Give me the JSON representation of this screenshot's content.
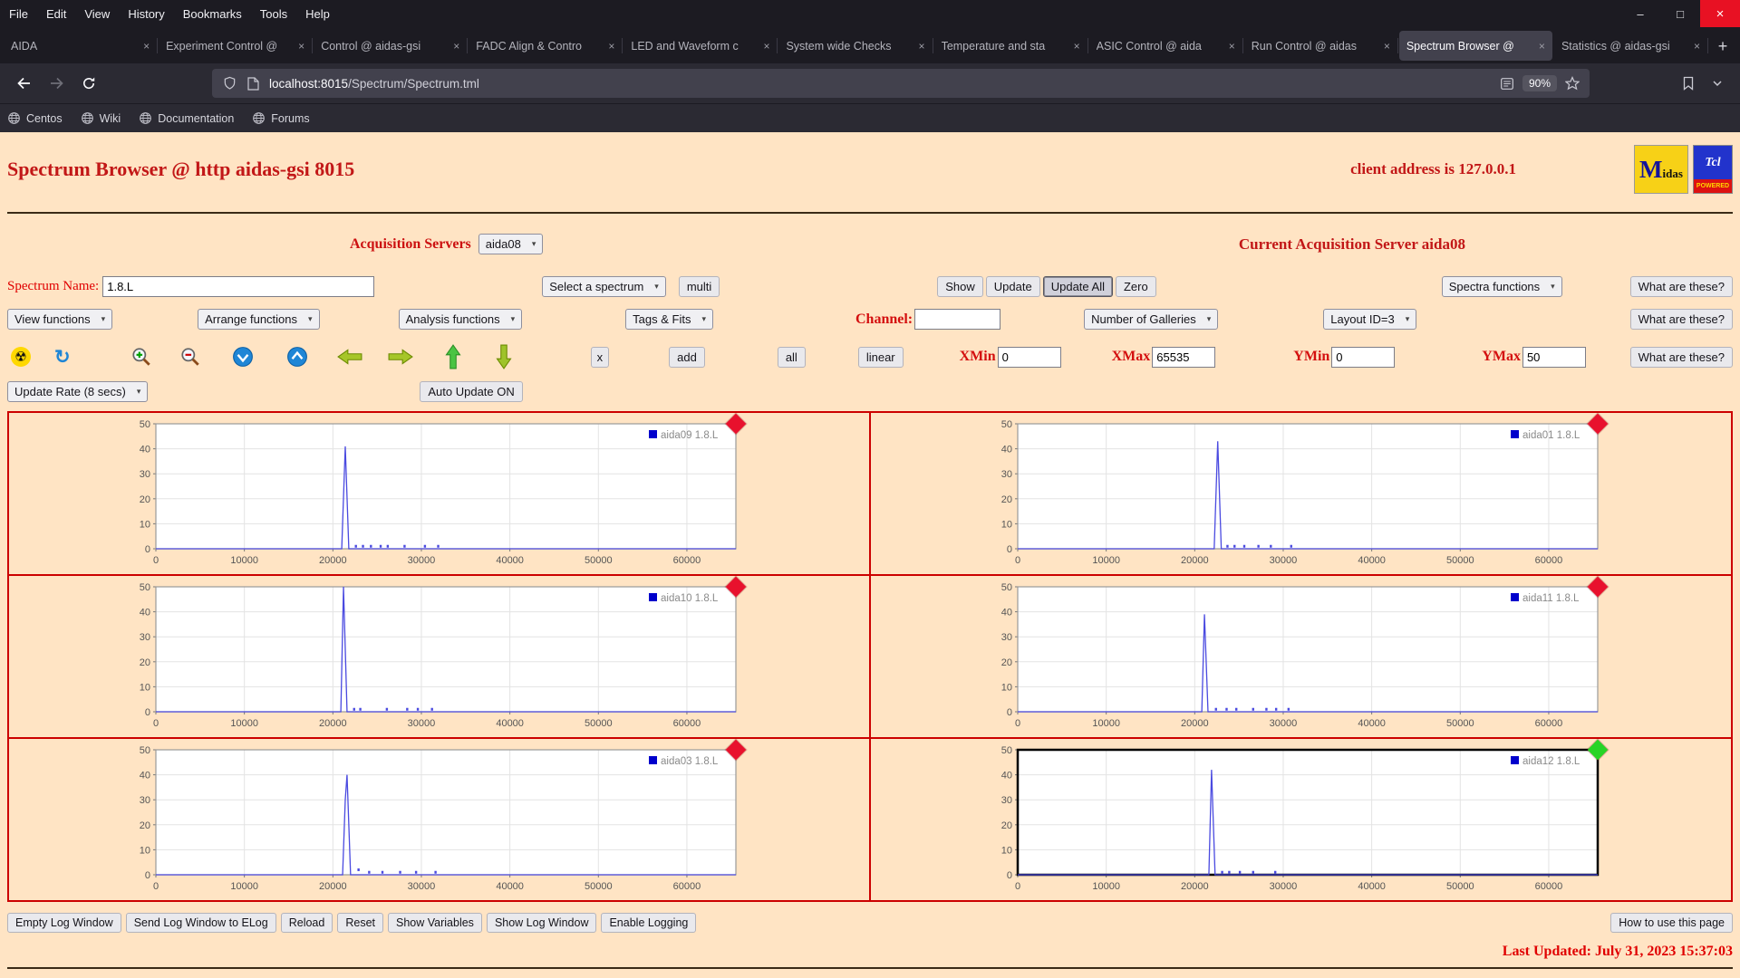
{
  "icons": {
    "close": "×",
    "minimize": "–",
    "maximize": "□",
    "new_tab": "+",
    "caret": "▾",
    "radiation": "☢",
    "refresh": "↻"
  },
  "colors": {
    "page_bg": "#ffe4c4",
    "label_red": "#e00000",
    "header_red": "#c21717",
    "panel_border": "#cc0000",
    "spectrum_line": "#4a4ae0",
    "legend_square": "#0000cc",
    "status_red": "#e8112d",
    "status_green": "#27d427"
  },
  "browser": {
    "menu": {
      "items": [
        "File",
        "Edit",
        "View",
        "History",
        "Bookmarks",
        "Tools",
        "Help"
      ]
    },
    "tabs": [
      {
        "title": "AIDA",
        "active": false
      },
      {
        "title": "Experiment Control @",
        "active": false
      },
      {
        "title": "Control @ aidas-gsi",
        "active": false
      },
      {
        "title": "FADC Align & Contro",
        "active": false
      },
      {
        "title": "LED and Waveform c",
        "active": false
      },
      {
        "title": "System wide Checks",
        "active": false
      },
      {
        "title": "Temperature and sta",
        "active": false
      },
      {
        "title": "ASIC Control @ aida",
        "active": false
      },
      {
        "title": "Run Control @ aidas",
        "active": false
      },
      {
        "title": "Spectrum Browser @",
        "active": true
      },
      {
        "title": "Statistics @ aidas-gsi",
        "active": false
      }
    ],
    "nav": {
      "url_host": "localhost:8015",
      "url_path": "/Spectrum/Spectrum.tml",
      "zoom": "90%"
    },
    "bookmarks": [
      "Centos",
      "Wiki",
      "Documentation",
      "Forums"
    ]
  },
  "page": {
    "title": "Spectrum Browser @ http aidas-gsi 8015",
    "client_address": "client address is 127.0.0.1",
    "logos": {
      "midas": "Midas",
      "tcl_top": "Tcl",
      "tcl_bottom": "POWERED"
    },
    "acquisition": {
      "label": "Acquisition Servers",
      "selected": "aida08",
      "current": "Current Acquisition Server aida08"
    },
    "row1": {
      "spectrum_name_label": "Spectrum Name:",
      "spectrum_name_value": "1.8.L",
      "select_spectrum": "Select a spectrum",
      "multi": "multi",
      "show": "Show",
      "update": "Update",
      "update_all": "Update All",
      "zero": "Zero",
      "spectra_functions": "Spectra functions",
      "help": "What are these?"
    },
    "row2": {
      "view_functions": "View functions",
      "arrange_functions": "Arrange functions",
      "analysis_functions": "Analysis functions",
      "tags_fits": "Tags & Fits",
      "channel_label": "Channel:",
      "channel_value": "",
      "number_of_galleries": "Number of Galleries",
      "layout_id": "Layout ID=3",
      "help": "What are these?"
    },
    "row3": {
      "x": "x",
      "add": "add",
      "all": "all",
      "linear": "linear",
      "xmin_label": "XMin",
      "xmin": "0",
      "xmax_label": "XMax",
      "xmax": "65535",
      "ymin_label": "YMin",
      "ymin": "0",
      "ymax_label": "YMax",
      "ymax": "50",
      "help": "What are these?"
    },
    "row4": {
      "update_rate": "Update Rate (8 secs)",
      "auto_update": "Auto Update ON"
    },
    "footer": {
      "buttons": [
        "Empty Log Window",
        "Send Log Window to ELog",
        "Reload",
        "Reset",
        "Show Variables",
        "Show Log Window",
        "Enable Logging"
      ],
      "help": "How to use this page",
      "last_updated": "Last Updated: July 31, 2023 15:37:03"
    }
  },
  "gallery": {
    "axes": {
      "xmin": 0,
      "xmax": 65535,
      "ymin": 0,
      "ymax": 50,
      "x_ticks": [
        0,
        10000,
        20000,
        30000,
        40000,
        50000,
        60000
      ],
      "y_ticks": [
        0,
        10,
        20,
        30,
        40,
        50
      ]
    },
    "panels": [
      {
        "legend": "aida09 1.8.L",
        "status": "#e8112d",
        "selected": false,
        "chart": 0
      },
      {
        "legend": "aida01 1.8.L",
        "status": "#e8112d",
        "selected": false,
        "chart": 1
      },
      {
        "legend": "aida10 1.8.L",
        "status": "#e8112d",
        "selected": false,
        "chart": 2
      },
      {
        "legend": "aida11 1.8.L",
        "status": "#e8112d",
        "selected": false,
        "chart": 3
      },
      {
        "legend": "aida03 1.8.L",
        "status": "#e8112d",
        "selected": false,
        "chart": 4
      },
      {
        "legend": "aida12 1.8.L",
        "status": "#27d427",
        "selected": true,
        "chart": 5
      }
    ]
  },
  "chart_data": [
    {
      "type": "line",
      "title": "aida09 1.8.L",
      "xlim": [
        0,
        65535
      ],
      "ylim": [
        0,
        50
      ],
      "series": [
        {
          "name": "aida09 1.8.L",
          "points": [
            [
              0,
              0
            ],
            [
              21000,
              0
            ],
            [
              21400,
              41
            ],
            [
              21800,
              0
            ],
            [
              65535,
              0
            ]
          ]
        }
      ],
      "noise_points": [
        [
          22600,
          1
        ],
        [
          23400,
          1
        ],
        [
          24300,
          1
        ],
        [
          25400,
          1
        ],
        [
          26200,
          1
        ],
        [
          28100,
          1
        ],
        [
          30400,
          1
        ],
        [
          31900,
          1
        ]
      ]
    },
    {
      "type": "line",
      "title": "aida01 1.8.L",
      "xlim": [
        0,
        65535
      ],
      "ylim": [
        0,
        50
      ],
      "series": [
        {
          "name": "aida01 1.8.L",
          "points": [
            [
              0,
              0
            ],
            [
              22200,
              0
            ],
            [
              22600,
              43
            ],
            [
              23000,
              0
            ],
            [
              65535,
              0
            ]
          ]
        }
      ],
      "noise_points": [
        [
          23700,
          1
        ],
        [
          24500,
          1
        ],
        [
          25600,
          1
        ],
        [
          27200,
          1
        ],
        [
          28600,
          1
        ],
        [
          30900,
          1
        ]
      ]
    },
    {
      "type": "line",
      "title": "aida10 1.8.L",
      "xlim": [
        0,
        65535
      ],
      "ylim": [
        0,
        50
      ],
      "series": [
        {
          "name": "aida10 1.8.L",
          "points": [
            [
              0,
              0
            ],
            [
              20900,
              0
            ],
            [
              21200,
              50
            ],
            [
              21600,
              0
            ],
            [
              65535,
              0
            ]
          ]
        }
      ],
      "noise_points": [
        [
          22400,
          1
        ],
        [
          23100,
          1
        ],
        [
          26100,
          1
        ],
        [
          28400,
          1
        ],
        [
          29600,
          1
        ],
        [
          31200,
          1
        ]
      ]
    },
    {
      "type": "line",
      "title": "aida11 1.8.L",
      "xlim": [
        0,
        65535
      ],
      "ylim": [
        0,
        50
      ],
      "series": [
        {
          "name": "aida11 1.8.L",
          "points": [
            [
              0,
              0
            ],
            [
              20800,
              0
            ],
            [
              21100,
              39
            ],
            [
              21500,
              0
            ],
            [
              65535,
              0
            ]
          ]
        }
      ],
      "noise_points": [
        [
          22400,
          1
        ],
        [
          23600,
          1
        ],
        [
          24700,
          1
        ],
        [
          26600,
          1
        ],
        [
          28100,
          1
        ],
        [
          29200,
          1
        ],
        [
          30600,
          1
        ]
      ]
    },
    {
      "type": "line",
      "title": "aida03 1.8.L",
      "xlim": [
        0,
        65535
      ],
      "ylim": [
        0,
        50
      ],
      "series": [
        {
          "name": "aida03 1.8.L",
          "points": [
            [
              0,
              0
            ],
            [
              21100,
              0
            ],
            [
              21400,
              30
            ],
            [
              21600,
              40
            ],
            [
              22000,
              0
            ],
            [
              65535,
              0
            ]
          ]
        }
      ],
      "noise_points": [
        [
          22900,
          2
        ],
        [
          24100,
          1
        ],
        [
          25600,
          1
        ],
        [
          27600,
          1
        ],
        [
          29400,
          1
        ],
        [
          31600,
          1
        ]
      ]
    },
    {
      "type": "line",
      "title": "aida12 1.8.L",
      "xlim": [
        0,
        65535
      ],
      "ylim": [
        0,
        50
      ],
      "series": [
        {
          "name": "aida12 1.8.L",
          "points": [
            [
              0,
              0
            ],
            [
              21600,
              0
            ],
            [
              21900,
              42
            ],
            [
              22300,
              0
            ],
            [
              65535,
              0
            ]
          ]
        }
      ],
      "noise_points": [
        [
          23100,
          1
        ],
        [
          23900,
          1
        ],
        [
          25100,
          1
        ],
        [
          26600,
          1
        ],
        [
          29100,
          1
        ]
      ]
    }
  ]
}
